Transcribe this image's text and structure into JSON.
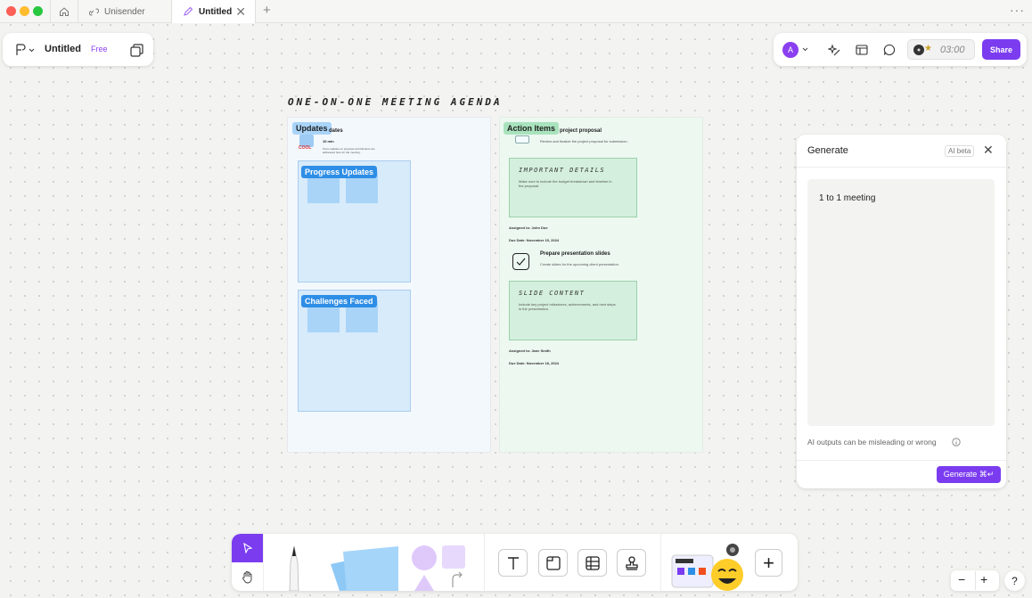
{
  "tabs": [
    {
      "label": "Unisender"
    },
    {
      "label": "Untitled"
    }
  ],
  "tab_close": "✕",
  "tab_add": "+",
  "more": "···",
  "file": {
    "name": "Untitled",
    "plan": "Free"
  },
  "user": {
    "avatar": "A"
  },
  "timer": "03:00",
  "share_label": "Share",
  "board": {
    "title": "ONE-ON-ONE MEETING AGENDA",
    "updates": {
      "label": "Updates",
      "item_title": "dates",
      "duration": "10 min",
      "desc": "Team updates on progress and blockers are addressed here for the meeting.",
      "sticker": "COOL",
      "progress_tag": "Progress Updates",
      "challenges_tag": "Challenges Faced"
    },
    "actions": {
      "label": "Action Items",
      "item1_title": "project proposal",
      "item1_desc": "Review and finalize the project proposal for submission.",
      "card1_heading": "IMPORTANT DETAILS",
      "card1_body": "Make sure to include the budget breakdown and timeline in the proposal.",
      "assigned1": "Assigned to: John Doe",
      "due1": "Due Date: November 15, 2024",
      "item2_title": "Prepare presentation slides",
      "item2_desc": "Create slides for the upcoming client presentation.",
      "card2_heading": "SLIDE CONTENT",
      "card2_body": "Include key project milestones, achievements, and next steps in the presentation.",
      "assigned2": "Assigned to: Jane Smith",
      "due2": "Due Date: November 18, 2024"
    }
  },
  "generate": {
    "title": "Generate",
    "badge": "AI beta",
    "prompt": "1 to 1 meeting",
    "disclaimer": "AI outputs can be misleading or wrong",
    "button": "Generate ⌘↵"
  },
  "zoom": {
    "minus": "−",
    "plus": "+",
    "help": "?"
  },
  "toolbar_add": "+",
  "colors": {
    "accent": "#7b3cf0",
    "updates_bg": "#f3f8fd",
    "actions_bg": "#edf8f1",
    "blue_tag": "#2e8ee6",
    "green_card": "#d4efdd"
  },
  "icons": [
    "home-icon",
    "link-icon",
    "pen-icon",
    "close-icon",
    "plus-icon",
    "figjam-logo-icon",
    "layers-icon",
    "ai-sparkle-icon",
    "table-icon",
    "comment-icon",
    "cursor-icon",
    "hand-icon",
    "marker-icon",
    "sticky-note-icon",
    "shapes-icon",
    "connector-icon",
    "text-icon",
    "section-icon",
    "table-tool-icon",
    "stamp-icon",
    "widgets-icon",
    "checkbox-icon",
    "info-icon"
  ]
}
